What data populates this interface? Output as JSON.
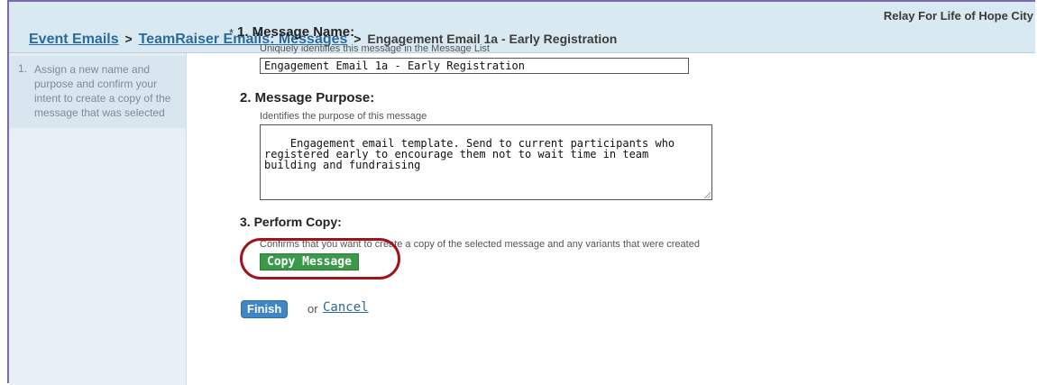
{
  "header": {
    "org_name": "Relay For Life of Hope City",
    "breadcrumb": {
      "link1": "Event Emails",
      "sep1": ">",
      "link2": "TeamRaiser Emails: Messages",
      "sep2": ">",
      "current": "Engagement Email 1a - Early Registration"
    }
  },
  "sidebar": {
    "steps": [
      {
        "number": "1.",
        "text": "Assign a new name and purpose and confirm your intent to create a copy of the message that was selected"
      }
    ]
  },
  "form": {
    "required_mark": "*",
    "name": {
      "title": "1. Message Name:",
      "help": "Uniquely identifies this message in the Message List",
      "value": "Engagement Email 1a - Early Registration"
    },
    "purpose": {
      "title": "2. Message Purpose:",
      "help": "Identifies the purpose of this message",
      "value": "Engagement email template. Send to current participants who\nregistered early to encourage them not to wait time in team\nbuilding and fundraising"
    },
    "copy": {
      "title": "3. Perform Copy:",
      "help": "Confirms that you want to create a copy of the selected message and any variants that were created",
      "button_label": "Copy Message"
    },
    "finish_label": "Finish",
    "or_text": "or",
    "cancel_label": "Cancel"
  },
  "colors": {
    "header_bg": "#d9e9f2",
    "link": "#2c6a9a",
    "copy_button": "#3a9a4a",
    "finish_button": "#3f86c7",
    "highlight_ring": "#a2141c"
  }
}
